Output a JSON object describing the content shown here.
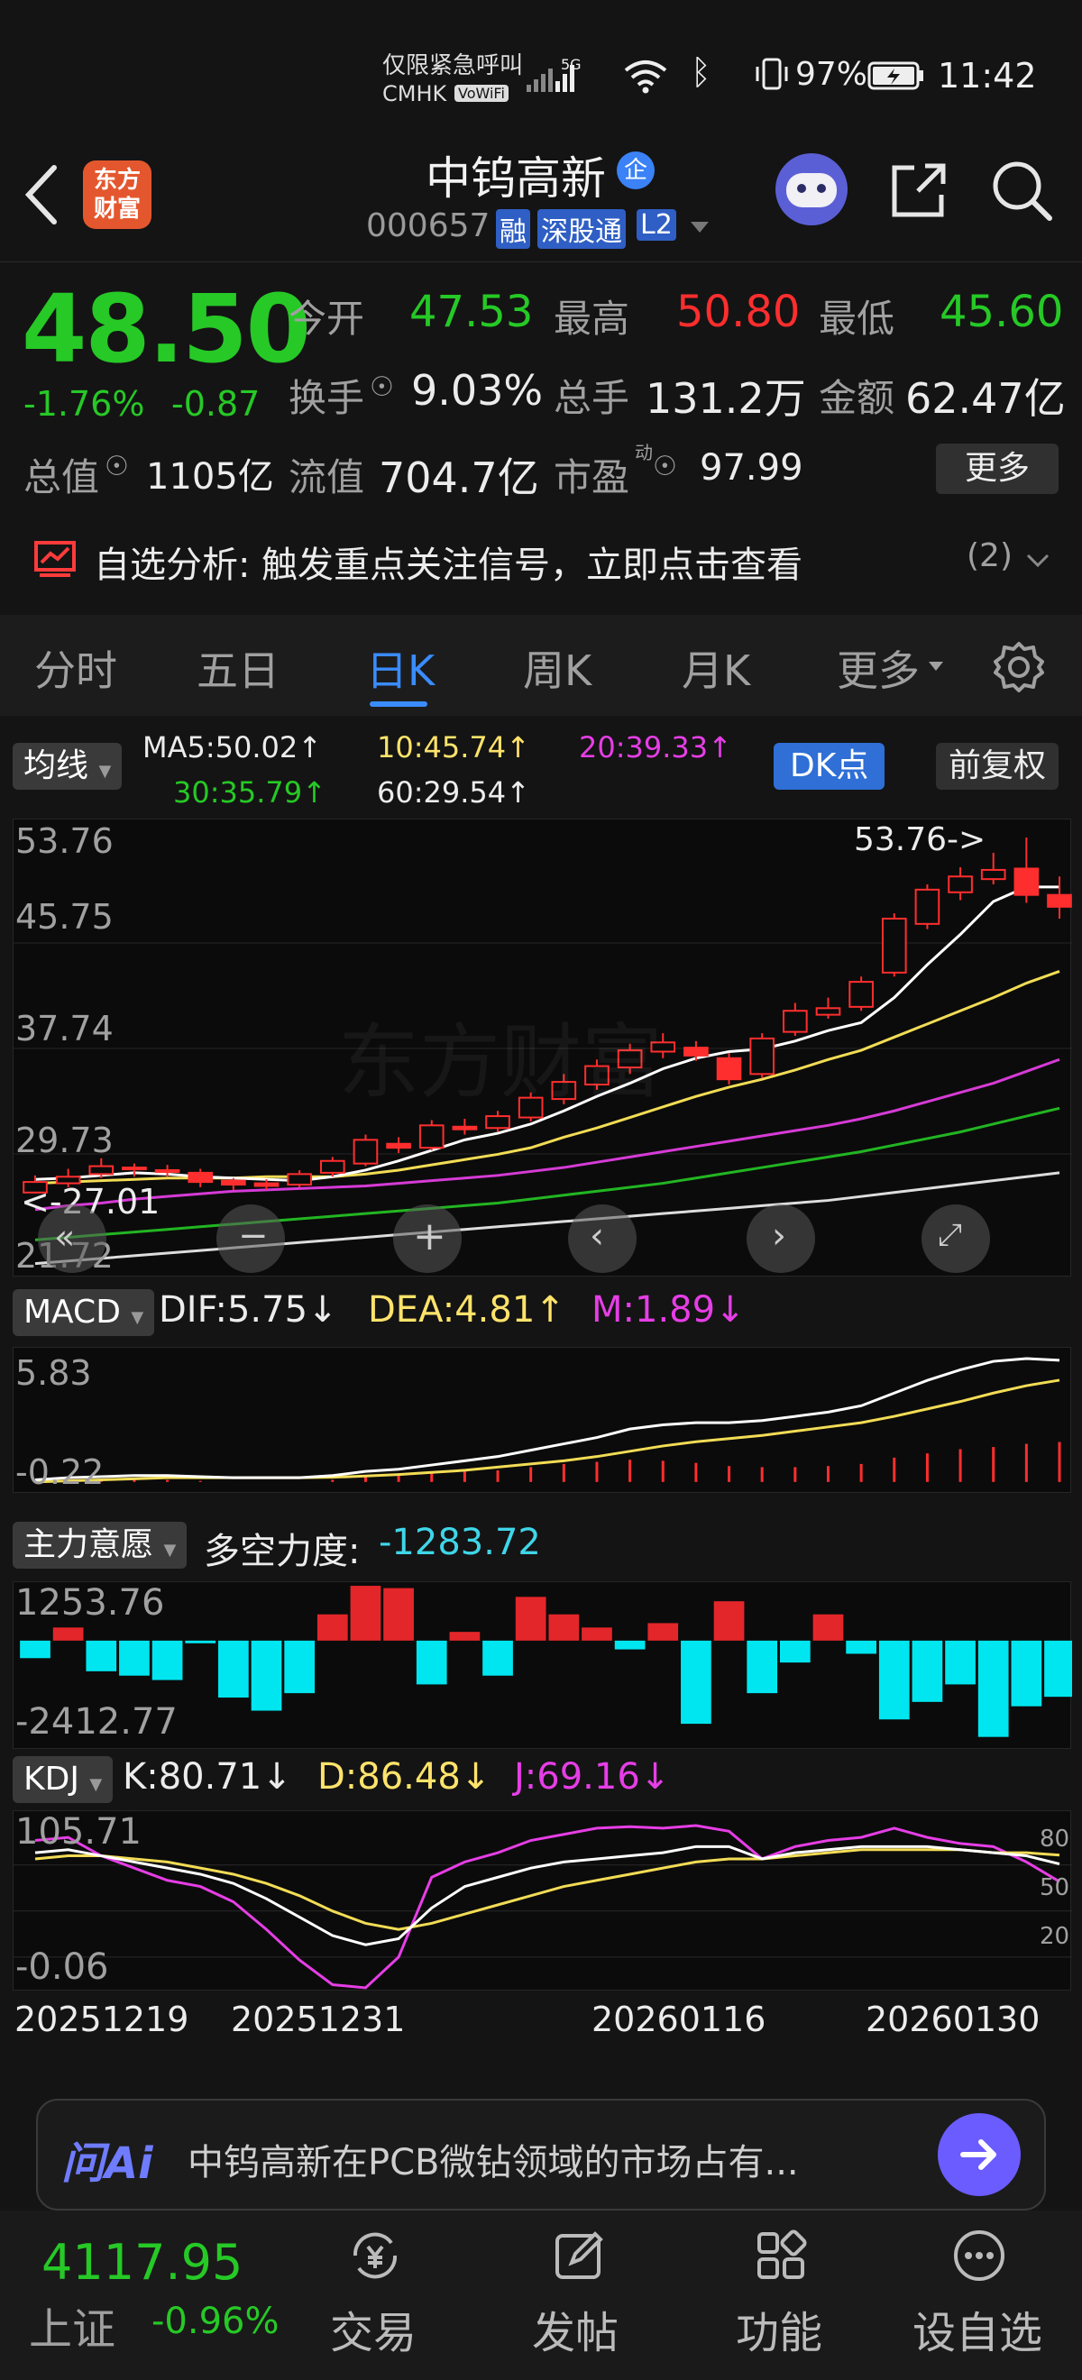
{
  "status": {
    "line1": "仅限紧急呼叫",
    "line2": "CMHK",
    "line2_badge": "VoWiFi",
    "signal_label": "5G",
    "battery": "97%",
    "time": "11:42"
  },
  "header": {
    "logo_text": "东方财富",
    "stock_name": "中钨高新",
    "enterprise_badge": "企",
    "code": "000657",
    "tags": [
      "融",
      "深股通",
      "L2"
    ]
  },
  "quote": {
    "price": "48.50",
    "change_pct": "-1.76%",
    "change": "-0.87",
    "open_label": "今开",
    "open": "47.53",
    "high_label": "最高",
    "high": "50.80",
    "low_label": "最低",
    "low": "45.60",
    "turnover_label": "换手",
    "turnover": "9.03%",
    "volume_label": "总手",
    "volume": "131.2万",
    "amount_label": "金额",
    "amount": "62.47亿",
    "mcap_label": "总值",
    "mcap": "1105亿",
    "float_label": "流值",
    "float": "704.7亿",
    "pe_label": "市盈",
    "pe_sup": "动",
    "pe": "97.99",
    "more_button": "更多"
  },
  "analysis": {
    "label": "自选分析:",
    "text": "触发重点关注信号，立即点击查看",
    "count": "(2)"
  },
  "tabs": [
    "分时",
    "五日",
    "日K",
    "周K",
    "月K",
    "更多"
  ],
  "active_tab": "日K",
  "indicators": {
    "ma_button": "均线",
    "ma5": "MA5:50.02↑",
    "ma10": "10:45.74↑",
    "ma20": "20:39.33↑",
    "ma30": "30:35.79↑",
    "ma60": "60:29.54↑",
    "dk_button": "DK点",
    "fq_button": "前复权",
    "macd_button": "MACD",
    "dif": "DIF:5.75↓",
    "dea": "DEA:4.81↑",
    "m": "M:1.89↓",
    "zl_button": "主力意愿",
    "dk_force_label": "多空力度:",
    "dk_force": "-1283.72",
    "kdj_button": "KDJ",
    "k": "K:80.71↓",
    "d": "D:86.48↓",
    "j": "J:69.16↓"
  },
  "main_chart": {
    "ymax": "53.76",
    "y2": "45.75",
    "y3": "37.74",
    "y4": "29.73",
    "ymin": "21.72",
    "high_mark": "53.76->",
    "low_mark": "<-27.01",
    "watermark": "东方财富"
  },
  "macd_chart": {
    "ymax": "5.83",
    "ymin": "-0.22"
  },
  "force_chart": {
    "ymax": "1253.76",
    "ymin": "-2412.77"
  },
  "kdj_chart": {
    "ymax": "105.71",
    "ymin": "-0.06",
    "levels": [
      "80",
      "50",
      "20"
    ]
  },
  "dates": [
    "20251219",
    "20251231",
    "20260116",
    "20260130"
  ],
  "ai_bar": {
    "logo": "问Ai",
    "text": "中钨高新在PCB微钻领域的市场占有..."
  },
  "bottom_nav": {
    "index_value": "4117.95",
    "index_name": "上证",
    "index_change": "-0.96%",
    "items": [
      "交易",
      "发帖",
      "功能",
      "设自选"
    ]
  },
  "chart_data": {
    "type": "candlestick",
    "ohlc": [
      [
        26.8,
        27.6,
        27.0,
        28.1
      ],
      [
        27.5,
        28.0,
        27.2,
        28.6
      ],
      [
        28.2,
        28.8,
        27.9,
        29.4
      ],
      [
        28.6,
        28.7,
        28.0,
        29.0
      ],
      [
        28.4,
        28.5,
        28.0,
        28.9
      ],
      [
        28.3,
        27.6,
        27.2,
        28.6
      ],
      [
        27.7,
        27.4,
        27.0,
        27.9
      ],
      [
        27.5,
        27.3,
        27.0,
        27.8
      ],
      [
        27.4,
        28.2,
        27.2,
        28.5
      ],
      [
        28.3,
        29.2,
        28.0,
        29.5
      ],
      [
        29.0,
        30.8,
        28.8,
        31.2
      ],
      [
        30.5,
        30.2,
        29.8,
        31.0
      ],
      [
        30.2,
        31.9,
        30.0,
        32.3
      ],
      [
        31.8,
        31.6,
        31.2,
        32.4
      ],
      [
        31.7,
        32.6,
        31.4,
        33.0
      ],
      [
        32.5,
        34.0,
        32.2,
        34.4
      ],
      [
        33.9,
        35.2,
        33.5,
        35.8
      ],
      [
        35.0,
        36.4,
        34.6,
        36.9
      ],
      [
        36.3,
        37.6,
        35.8,
        38.1
      ],
      [
        37.5,
        38.2,
        37.0,
        38.9
      ],
      [
        37.8,
        37.2,
        36.8,
        38.3
      ],
      [
        37.0,
        35.4,
        35.0,
        37.4
      ],
      [
        35.8,
        38.5,
        35.5,
        38.9
      ],
      [
        39.0,
        40.6,
        38.7,
        41.2
      ],
      [
        40.3,
        40.8,
        40.0,
        41.6
      ],
      [
        40.9,
        42.8,
        40.6,
        43.2
      ],
      [
        43.5,
        47.6,
        43.2,
        48.0
      ],
      [
        47.2,
        49.8,
        46.8,
        50.2
      ],
      [
        49.6,
        50.8,
        49.0,
        51.5
      ],
      [
        50.6,
        51.3,
        50.2,
        52.6
      ],
      [
        51.4,
        49.4,
        48.8,
        53.76
      ],
      [
        49.4,
        48.5,
        47.6,
        50.8
      ]
    ],
    "ma5": [
      27.8,
      27.9,
      28.1,
      28.3,
      28.2,
      28.0,
      27.9,
      27.8,
      27.7,
      28.0,
      28.5,
      29.2,
      30.0,
      30.8,
      31.3,
      32.0,
      33.0,
      34.1,
      35.1,
      36.2,
      37.0,
      37.5,
      37.7,
      38.3,
      39.1,
      39.7,
      41.6,
      44.1,
      46.4,
      48.9,
      50.0,
      50.0
    ],
    "ma10": [
      27.5,
      27.6,
      27.7,
      27.8,
      27.9,
      27.9,
      27.9,
      28.0,
      28.0,
      28.0,
      28.2,
      28.5,
      28.9,
      29.3,
      29.7,
      30.2,
      31.0,
      31.7,
      32.5,
      33.3,
      34.1,
      34.8,
      35.4,
      36.1,
      36.9,
      37.6,
      38.6,
      39.6,
      40.6,
      41.6,
      42.7,
      43.6
    ],
    "ma20": [
      25.5,
      25.8,
      26.0,
      26.3,
      26.5,
      26.7,
      26.9,
      27.0,
      27.1,
      27.2,
      27.3,
      27.5,
      27.7,
      27.9,
      28.1,
      28.4,
      28.7,
      29.1,
      29.5,
      29.9,
      30.3,
      30.7,
      31.1,
      31.5,
      31.9,
      32.4,
      33.0,
      33.7,
      34.4,
      35.1,
      36.0,
      36.9
    ],
    "ma30": [
      23.2,
      23.4,
      23.6,
      23.8,
      24.0,
      24.2,
      24.4,
      24.6,
      24.8,
      25.0,
      25.2,
      25.4,
      25.6,
      25.8,
      26.0,
      26.3,
      26.6,
      26.9,
      27.2,
      27.5,
      27.9,
      28.3,
      28.7,
      29.1,
      29.5,
      29.9,
      30.4,
      30.9,
      31.4,
      32.0,
      32.6,
      33.2
    ],
    "ma60": [
      21.4,
      21.6,
      21.8,
      22.0,
      22.2,
      22.4,
      22.6,
      22.8,
      23.0,
      23.2,
      23.4,
      23.6,
      23.8,
      24.0,
      24.2,
      24.4,
      24.6,
      24.8,
      25.0,
      25.2,
      25.4,
      25.6,
      25.8,
      26.0,
      26.2,
      26.5,
      26.8,
      27.1,
      27.4,
      27.7,
      28.0,
      28.3
    ],
    "macd_dif": [
      0.1,
      0.2,
      0.25,
      0.3,
      0.3,
      0.25,
      0.2,
      0.2,
      0.2,
      0.3,
      0.5,
      0.6,
      0.8,
      1.0,
      1.2,
      1.5,
      1.8,
      2.1,
      2.5,
      2.7,
      2.8,
      2.8,
      2.9,
      3.1,
      3.3,
      3.6,
      4.2,
      4.8,
      5.3,
      5.7,
      5.83,
      5.75
    ],
    "macd_dea": [
      0.0,
      0.05,
      0.1,
      0.15,
      0.2,
      0.2,
      0.2,
      0.2,
      0.2,
      0.22,
      0.28,
      0.35,
      0.45,
      0.55,
      0.7,
      0.85,
      1.0,
      1.2,
      1.45,
      1.7,
      1.9,
      2.05,
      2.2,
      2.4,
      2.6,
      2.8,
      3.1,
      3.45,
      3.8,
      4.2,
      4.55,
      4.81
    ],
    "macd_bar": [
      0.1,
      0.15,
      0.15,
      0.15,
      0.1,
      0.05,
      0.0,
      0.0,
      0.0,
      0.1,
      0.25,
      0.3,
      0.4,
      0.5,
      0.55,
      0.7,
      0.85,
      0.95,
      1.05,
      1.0,
      0.9,
      0.75,
      0.7,
      0.7,
      0.75,
      0.85,
      1.15,
      1.35,
      1.55,
      1.65,
      1.8,
      1.89
    ],
    "force": [
      -400,
      300,
      -700,
      -800,
      -900,
      -60,
      -1300,
      -1600,
      -1200,
      600,
      1253,
      1200,
      -1000,
      200,
      -800,
      1000,
      600,
      300,
      -200,
      400,
      -1900,
      900,
      -1200,
      -500,
      600,
      -300,
      -1800,
      -1400,
      -1000,
      -2200,
      -1500,
      -1283
    ],
    "kdj_k": [
      88,
      90,
      86,
      82,
      78,
      74,
      68,
      58,
      46,
      34,
      28,
      32,
      52,
      66,
      72,
      78,
      82,
      84,
      86,
      88,
      92,
      92,
      84,
      88,
      90,
      92,
      92,
      92,
      90,
      88,
      86,
      80.71
    ],
    "kdj_d": [
      84,
      86,
      86,
      84,
      82,
      78,
      74,
      68,
      60,
      50,
      42,
      38,
      42,
      48,
      54,
      60,
      66,
      70,
      74,
      78,
      82,
      84,
      84,
      86,
      88,
      90,
      90,
      90,
      90,
      88,
      88,
      86.48
    ],
    "kdj_j": [
      96,
      98,
      86,
      78,
      70,
      66,
      56,
      38,
      18,
      2,
      -0.06,
      20,
      72,
      82,
      88,
      96,
      100,
      104,
      105,
      104,
      105.71,
      102,
      84,
      92,
      96,
      98,
      104,
      98,
      94,
      92,
      82,
      69.16
    ]
  }
}
